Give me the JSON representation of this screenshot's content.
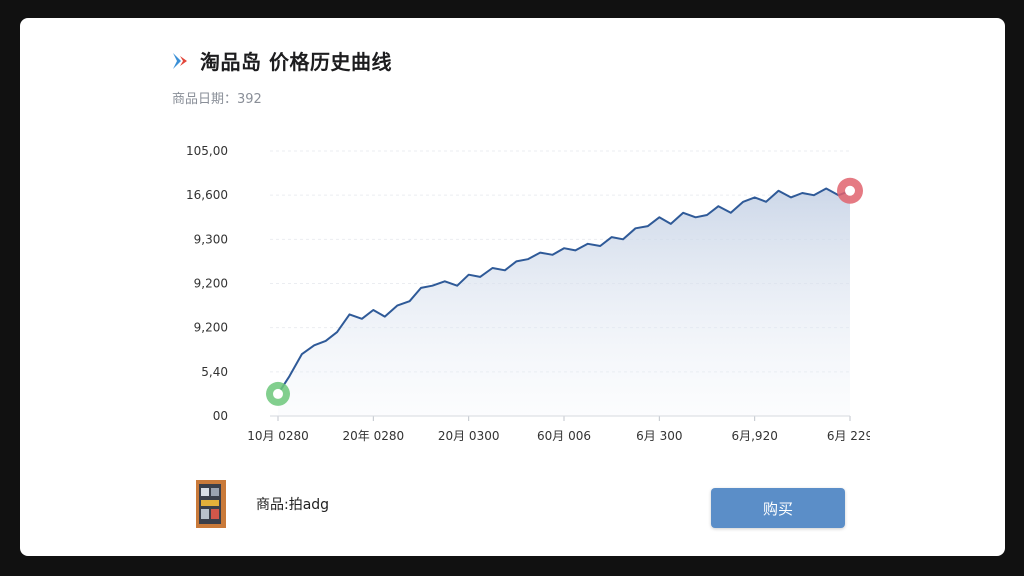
{
  "header": {
    "title": "淘品岛 价格历史曲线"
  },
  "subtitle": "商品日期：392",
  "product": {
    "name": "商品:拍adg"
  },
  "buy_label": "购买",
  "colors": {
    "line": "#2f5a98",
    "start_marker": "#6cc77a",
    "end_marker": "#e0636d",
    "button": "#5b8ec8"
  },
  "chart_data": {
    "type": "line",
    "y_ticks": [
      "105,00",
      "16,600",
      "9,300",
      "9,200",
      "9,200",
      "5,40",
      "00"
    ],
    "x_ticks": [
      "10月 0280",
      "20年 0280",
      "20月 0300",
      "60月 006",
      "6月 300",
      "6月,920",
      "6月 229"
    ],
    "ylim": [
      0,
      6
    ],
    "xlim": [
      0,
      6
    ],
    "grid": true,
    "x": [
      0,
      0.12,
      0.25,
      0.38,
      0.5,
      0.62,
      0.75,
      0.88,
      1.0,
      1.12,
      1.25,
      1.38,
      1.5,
      1.62,
      1.75,
      1.88,
      2.0,
      2.12,
      2.25,
      2.38,
      2.5,
      2.62,
      2.75,
      2.88,
      3.0,
      3.12,
      3.25,
      3.38,
      3.5,
      3.62,
      3.75,
      3.88,
      4.0,
      4.12,
      4.25,
      4.38,
      4.5,
      4.62,
      4.75,
      4.88,
      5.0,
      5.12,
      5.25,
      5.38,
      5.5,
      5.62,
      5.75,
      5.88,
      6.0
    ],
    "values": [
      0.5,
      0.9,
      1.4,
      1.6,
      1.7,
      1.9,
      2.3,
      2.2,
      2.4,
      2.25,
      2.5,
      2.6,
      2.9,
      2.95,
      3.05,
      2.95,
      3.2,
      3.15,
      3.35,
      3.3,
      3.5,
      3.55,
      3.7,
      3.65,
      3.8,
      3.75,
      3.9,
      3.85,
      4.05,
      4.0,
      4.25,
      4.3,
      4.5,
      4.35,
      4.6,
      4.5,
      4.55,
      4.75,
      4.6,
      4.85,
      4.95,
      4.85,
      5.1,
      4.95,
      5.05,
      5.0,
      5.15,
      5.0,
      5.1
    ]
  }
}
